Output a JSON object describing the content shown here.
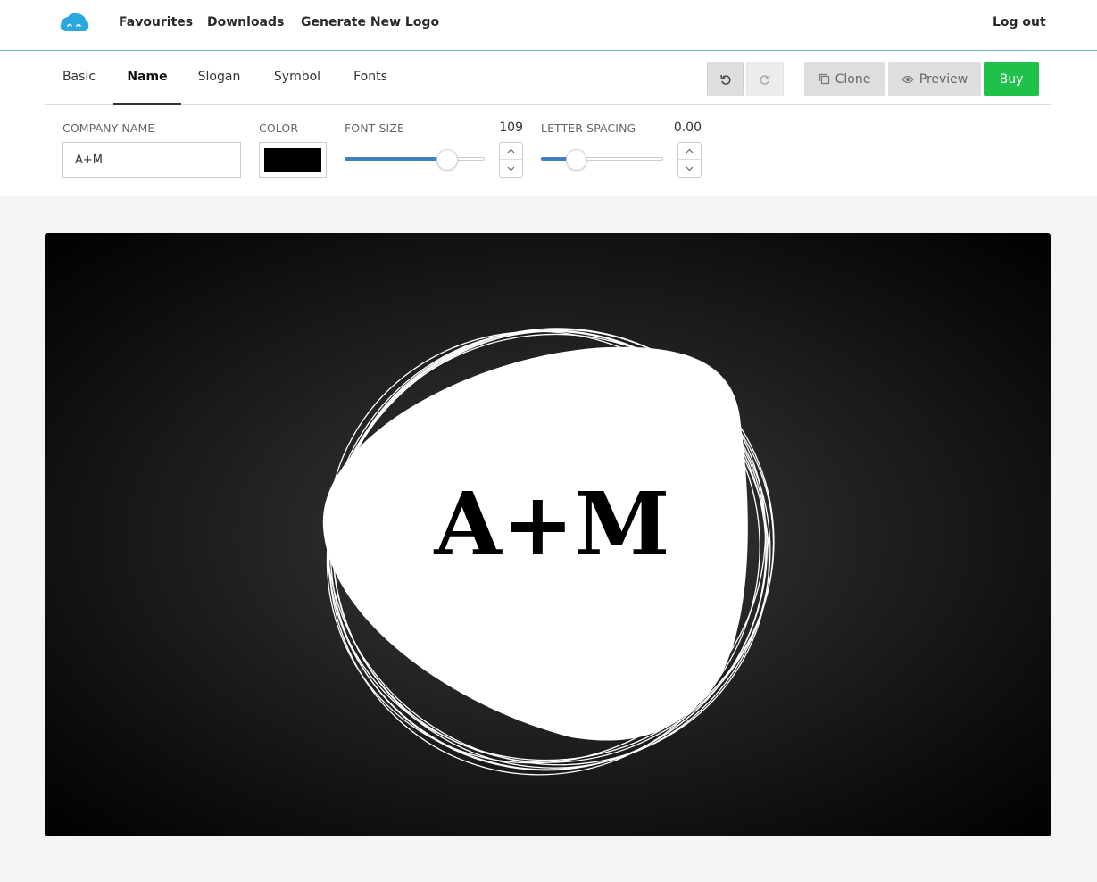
{
  "nav": {
    "logo_icon": "cloud-face-icon",
    "links": [
      "Favourites",
      "Downloads",
      "Generate New Logo"
    ],
    "logout": "Log out"
  },
  "tabs": [
    {
      "label": "Basic",
      "active": false
    },
    {
      "label": "Name",
      "active": true
    },
    {
      "label": "Slogan",
      "active": false
    },
    {
      "label": "Symbol",
      "active": false
    },
    {
      "label": "Fonts",
      "active": false
    }
  ],
  "toolbar": {
    "undo_icon": "undo-icon",
    "redo_icon": "redo-icon",
    "clone_label": "Clone",
    "preview_label": "Preview",
    "buy_label": "Buy"
  },
  "fields": {
    "company_name": {
      "label": "COMPANY NAME",
      "value": "A+M"
    },
    "color": {
      "label": "COLOR",
      "value": "#000000"
    },
    "font_size": {
      "label": "FONT SIZE",
      "value": "109",
      "slider_fraction": 0.73
    },
    "letter_spacing": {
      "label": "LETTER SPACING",
      "value": "0.00",
      "slider_fraction": 0.29
    }
  },
  "logo": {
    "text": "A+M",
    "text_color": "#000000",
    "shape_color": "#ffffff",
    "background": "dark radial gradient"
  },
  "colors": {
    "accent_blue": "#3f7fc4",
    "buy_green": "#20c14b",
    "brand_icon": "#2aa8dc"
  }
}
